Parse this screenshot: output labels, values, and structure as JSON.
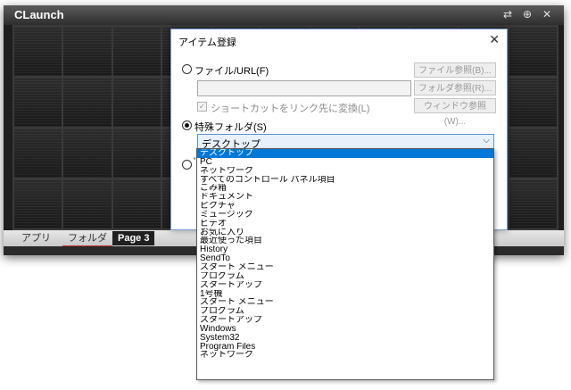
{
  "app": {
    "title": "CLaunch",
    "controls": [
      "⇄",
      "⊕",
      "✕"
    ],
    "tabs": [
      {
        "label": "アプリ",
        "active": false
      },
      {
        "label": "フォルダ",
        "active": false
      },
      {
        "label": "Page 3",
        "active": true
      }
    ]
  },
  "dialog": {
    "title": "アイテム登録",
    "close": "✕",
    "file_option": "ファイル/URL(F)",
    "file_buttons": [
      "ファイル参照(B)...",
      "フォルダ参照(R)...",
      "ウィンドウ参照(W)..."
    ],
    "shortcut_checkbox": "ショートカットをリンク先に変換(L)",
    "special_option": "特殊フォルダ(S)",
    "combo_value": "デスクトップ",
    "partial_radio_label": "'"
  },
  "dropdown": {
    "selected_index": 0,
    "items": [
      "デスクトップ",
      "PC",
      "ネットワーク",
      "すべてのコントロール パネル項目",
      "ごみ箱",
      "ドキュメント",
      "ピクチャ",
      "ミュージック",
      "ビデオ",
      "お気に入り",
      "最近使った項目",
      "History",
      "SendTo",
      "スタート メニュー",
      "プログラム",
      "スタートアップ",
      "1号機",
      "スタート メニュー",
      "プログラム",
      "スタートアップ",
      "Windows",
      "System32",
      "Program Files",
      "ネットワーク"
    ]
  }
}
